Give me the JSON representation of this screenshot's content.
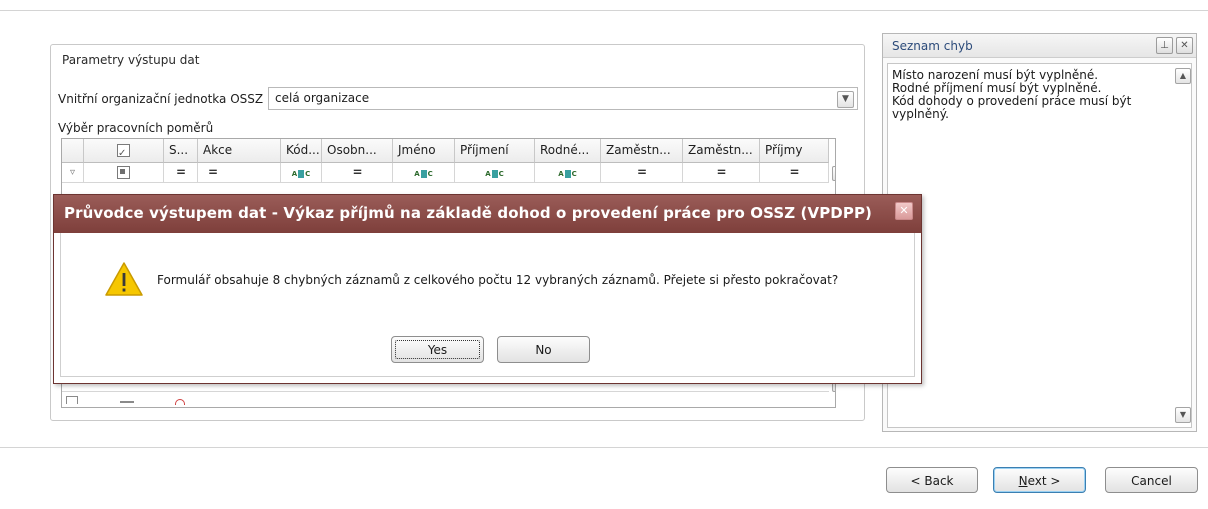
{
  "params": {
    "title": "Parametry výstupu dat",
    "unit_label": "Vnitřní organizační jednotka OSSZ",
    "unit_value": "celá organizace",
    "selection_label": "Výběr pracovních poměrů"
  },
  "grid": {
    "columns": [
      "",
      "",
      "S...",
      "Akce",
      "Kód...",
      "Osobn...",
      "Jméno",
      "Příjmení",
      "Rodné...",
      "Zaměstn...",
      "Zaměstn...",
      "Příjmy"
    ],
    "filter_row": [
      "filter-funnel",
      "checkbox",
      "=",
      "=",
      "abc",
      "=",
      "abc",
      "abc",
      "abc",
      "=",
      "=",
      "="
    ]
  },
  "errors": {
    "title": "Seznam chyb",
    "items": [
      "Místo narození musí být vyplněné.",
      "Rodné příjmení musí být vyplněné.",
      "Kód dohody o provedení práce musí být",
      "vyplněný."
    ]
  },
  "buttons": {
    "back": "< Back",
    "next_underline": "N",
    "next_rest": "ext >",
    "cancel": "Cancel"
  },
  "dialog": {
    "title": "Průvodce výstupem dat - Výkaz příjmů na základě dohod o provedení práce pro OSSZ (VPDPP)",
    "message": "Formulář obsahuje 8 chybných záznamů z celkového počtu 12 vybraných záznamů. Přejete si přesto pokračovat?",
    "yes": "Yes",
    "no": "No",
    "icon": "warning-icon",
    "title_color": "#7e3f3b"
  }
}
